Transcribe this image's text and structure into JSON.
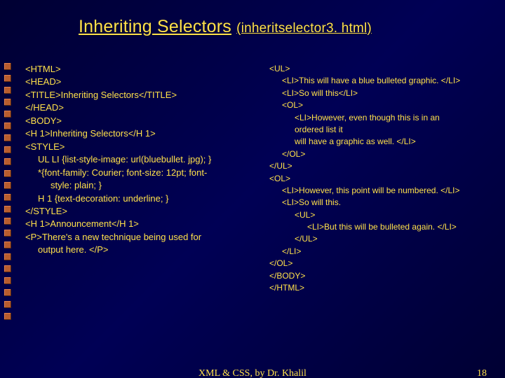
{
  "title": {
    "main": "Inheriting Selectors",
    "sub": "(inheritselector3. html)"
  },
  "left": {
    "l0": "<HTML>",
    "l1": "<HEAD>",
    "l2": "<TITLE>Inheriting Selectors</TITLE>",
    "l3": "</HEAD>",
    "l4": "<BODY>",
    "l5": "<H 1>Inheriting Selectors</H 1>",
    "l6": "<STYLE>",
    "l7": "UL LI {list-style-image: url(bluebullet. jpg); }",
    "l8": "*{font-family: Courier; font-size: 12pt; font-",
    "l8b": "style: plain; }",
    "l9": "H 1 {text-decoration: underline; }",
    "l10": "</STYLE>",
    "l11": "<H 1>Announcement</H 1>",
    "l12": "<P>There's a new technique being used for",
    "l12b": "output here. </P>"
  },
  "right": {
    "r0": "<UL>",
    "r1": "<LI>This will have a blue bulleted graphic. </LI>",
    "r2": "<LI>So will this</LI>",
    "r3": "<OL>",
    "r4": "<LI>However, even though this is in an",
    "r4b": "ordered list it",
    "r4c": "will have a graphic as well. </LI>",
    "r5": "</OL>",
    "r6": "</UL>",
    "r7": "<OL>",
    "r8": "<LI>However, this point will be numbered. </LI>",
    "r9": "<LI>So will this.",
    "r10": "<UL>",
    "r11": "<LI>But this will be bulleted again. </LI>",
    "r12": "</UL>",
    "r13": "</LI>",
    "r14": "</OL>",
    "r15": "</BODY>",
    "r16": "</HTML>"
  },
  "footer": {
    "center": "XML & CSS, by Dr. Khalil",
    "page": "18"
  },
  "bullet_count": 22
}
